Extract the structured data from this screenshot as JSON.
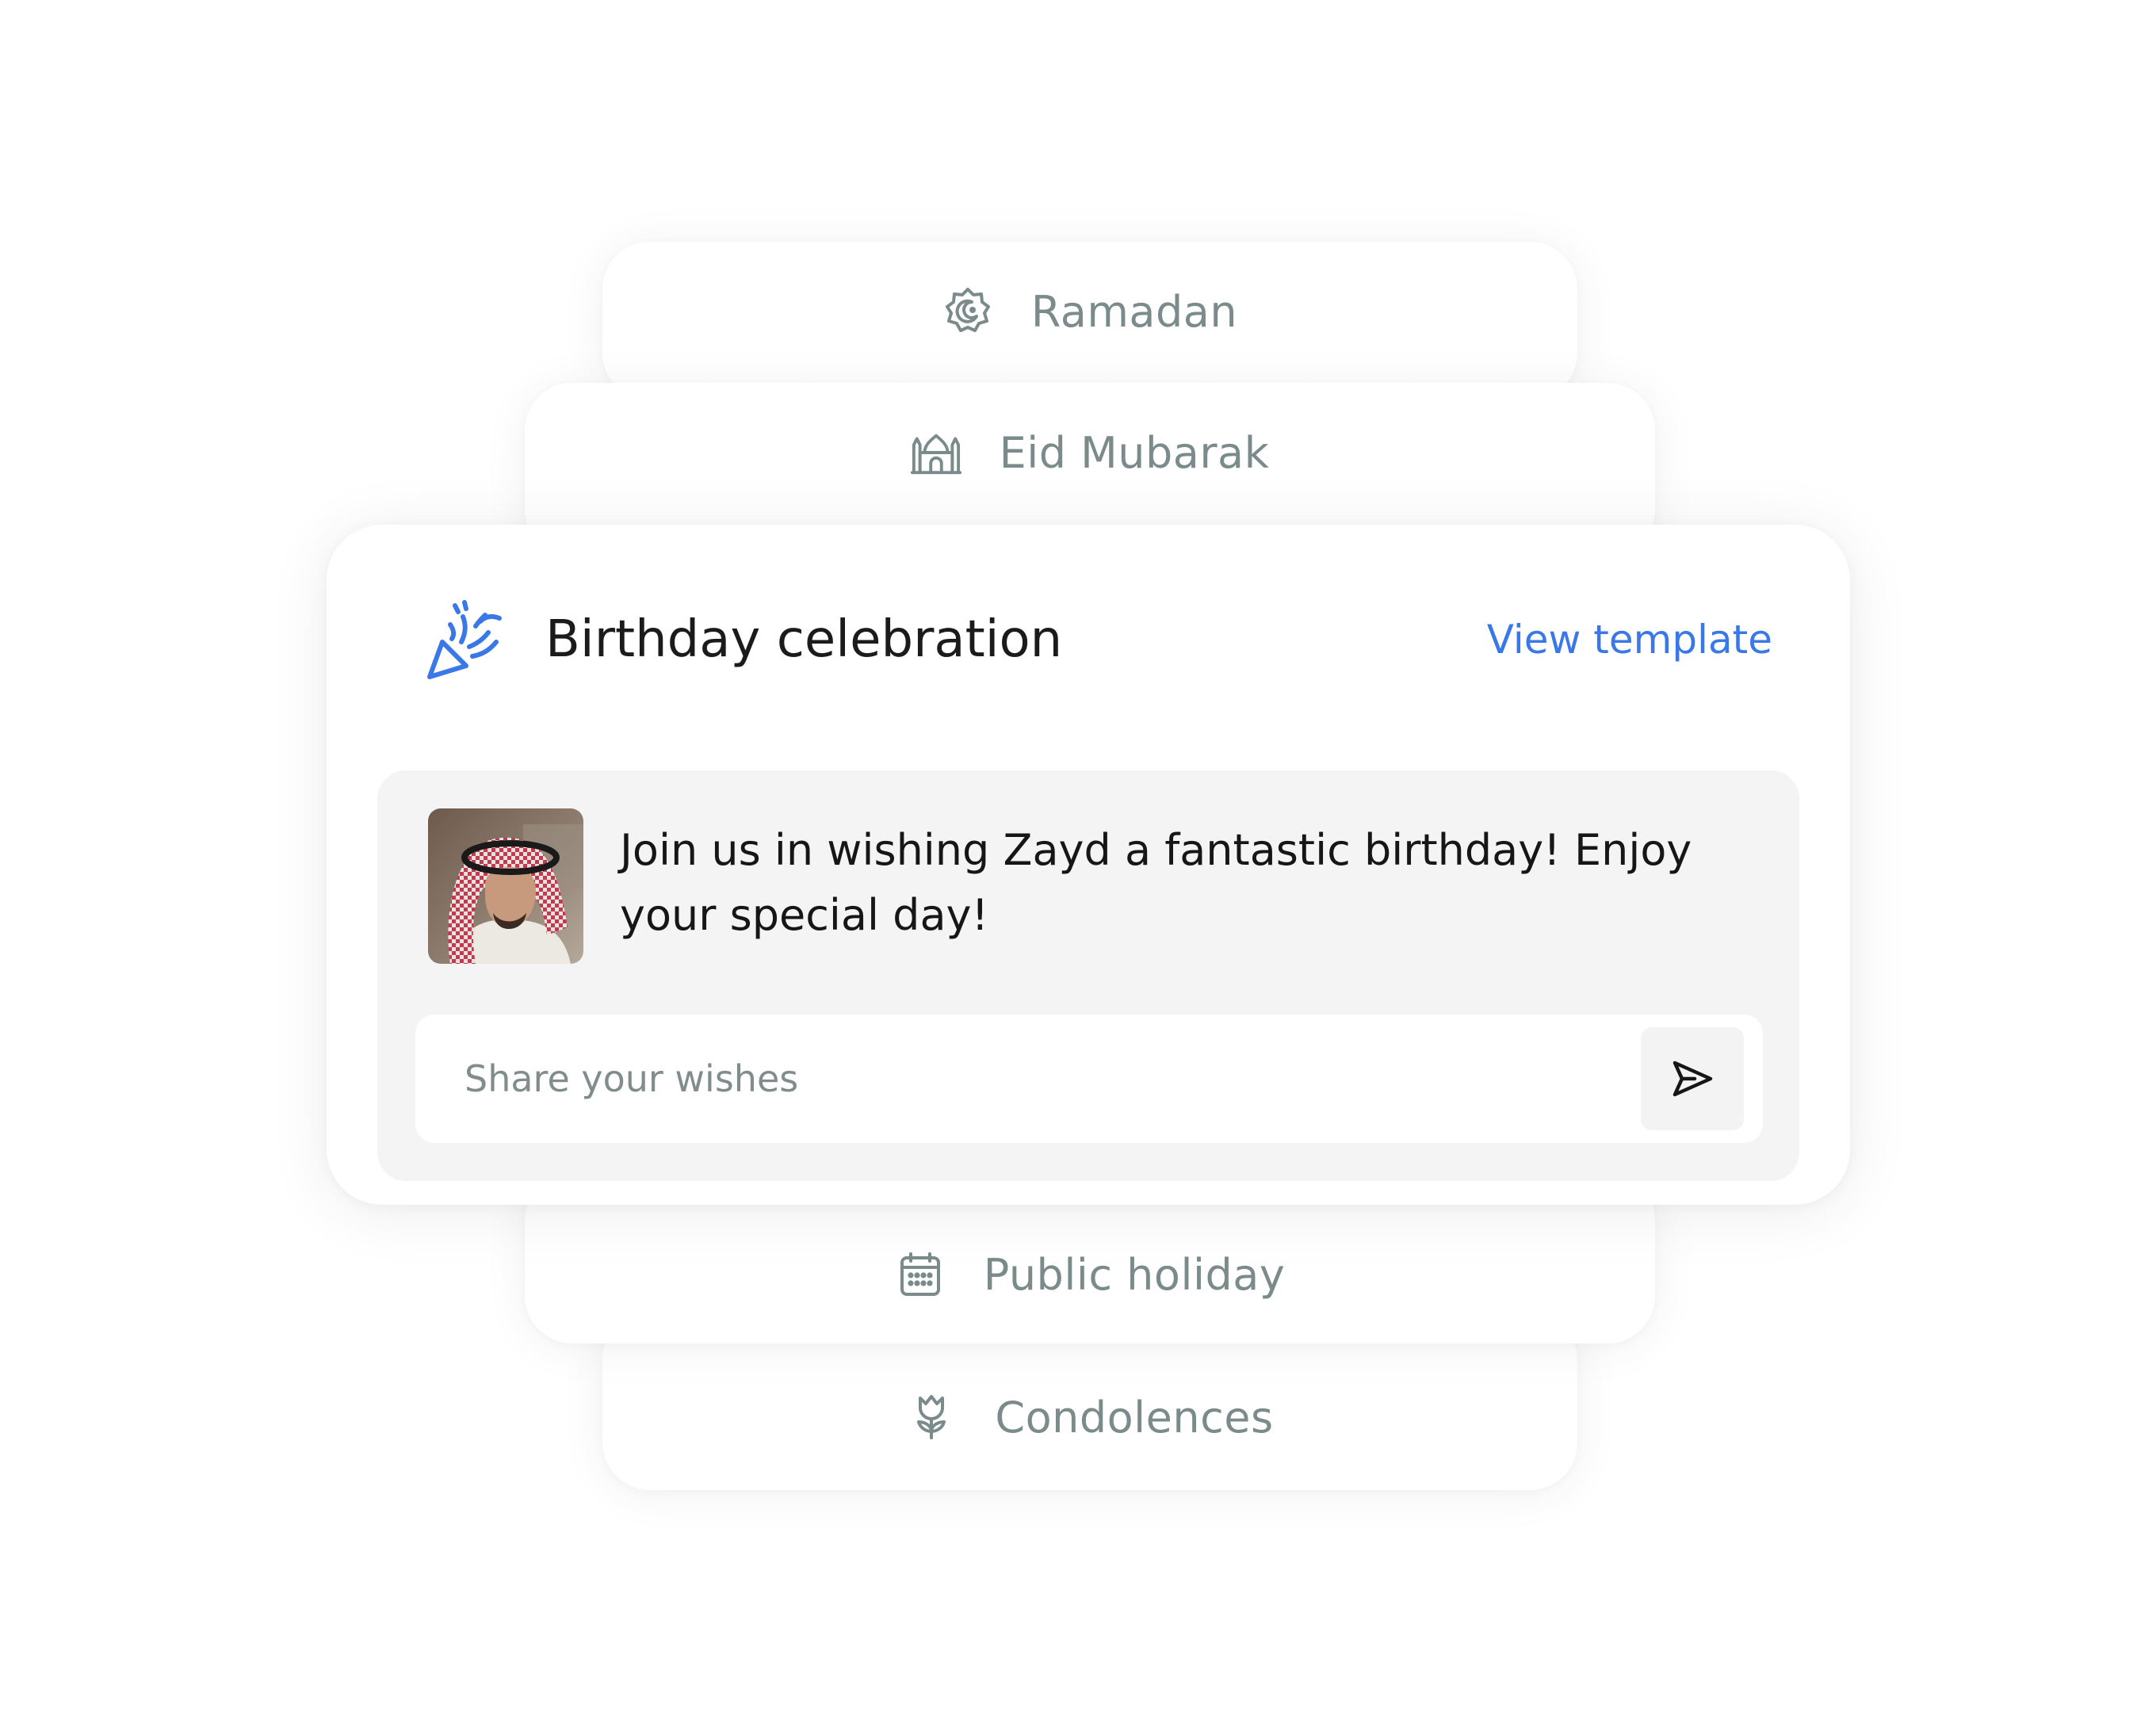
{
  "cards": {
    "ramadan": {
      "label": "Ramadan",
      "icon": "moon-star-badge-icon"
    },
    "eid": {
      "label": "Eid Mubarak",
      "icon": "mosque-icon"
    },
    "public_holiday": {
      "label": "Public holiday",
      "icon": "calendar-icon"
    },
    "condolences": {
      "label": "Condolences",
      "icon": "flower-icon"
    }
  },
  "main": {
    "title": "Birthday celebration",
    "icon": "party-popper-icon",
    "view_template_label": "View template",
    "message": "Join us in wishing Zayd a fantastic birthday! Enjoy your special day!",
    "input_placeholder": "Share your wishes",
    "send_icon": "send-icon"
  },
  "colors": {
    "accent": "#3b78e7",
    "muted_text": "#7b8a8a",
    "panel_bg": "#f4f4f4"
  }
}
